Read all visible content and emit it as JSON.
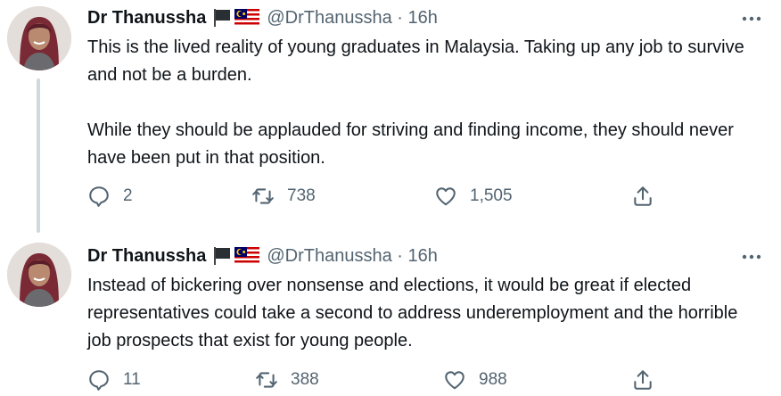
{
  "tweets": [
    {
      "author_name": "Dr Thanussha",
      "handle_time": "@DrThanussha · 16h",
      "paragraphs": [
        "This is the lived reality of young graduates in Malaysia. Taking up any job to survive and not be a burden.",
        "While they should be applauded for striving and finding income, they should never have been put in that position."
      ],
      "replies": "2",
      "retweets": "738",
      "likes": "1,505"
    },
    {
      "author_name": "Dr Thanussha",
      "handle_time": "@DrThanussha · 16h",
      "paragraphs": [
        "Instead of bickering over nonsense and elections, it would be great if elected representatives could take a second to address underemployment and the horrible job prospects that exist for young people."
      ],
      "replies": "11",
      "retweets": "388",
      "likes": "988"
    }
  ],
  "icons": {
    "reply": "reply-icon",
    "retweet": "retweet-icon",
    "like": "heart-icon",
    "share": "share-icon",
    "more": "more-icon"
  },
  "colors": {
    "text": "#0f1419",
    "secondary": "#536471",
    "thread_line": "#cfd9de"
  }
}
